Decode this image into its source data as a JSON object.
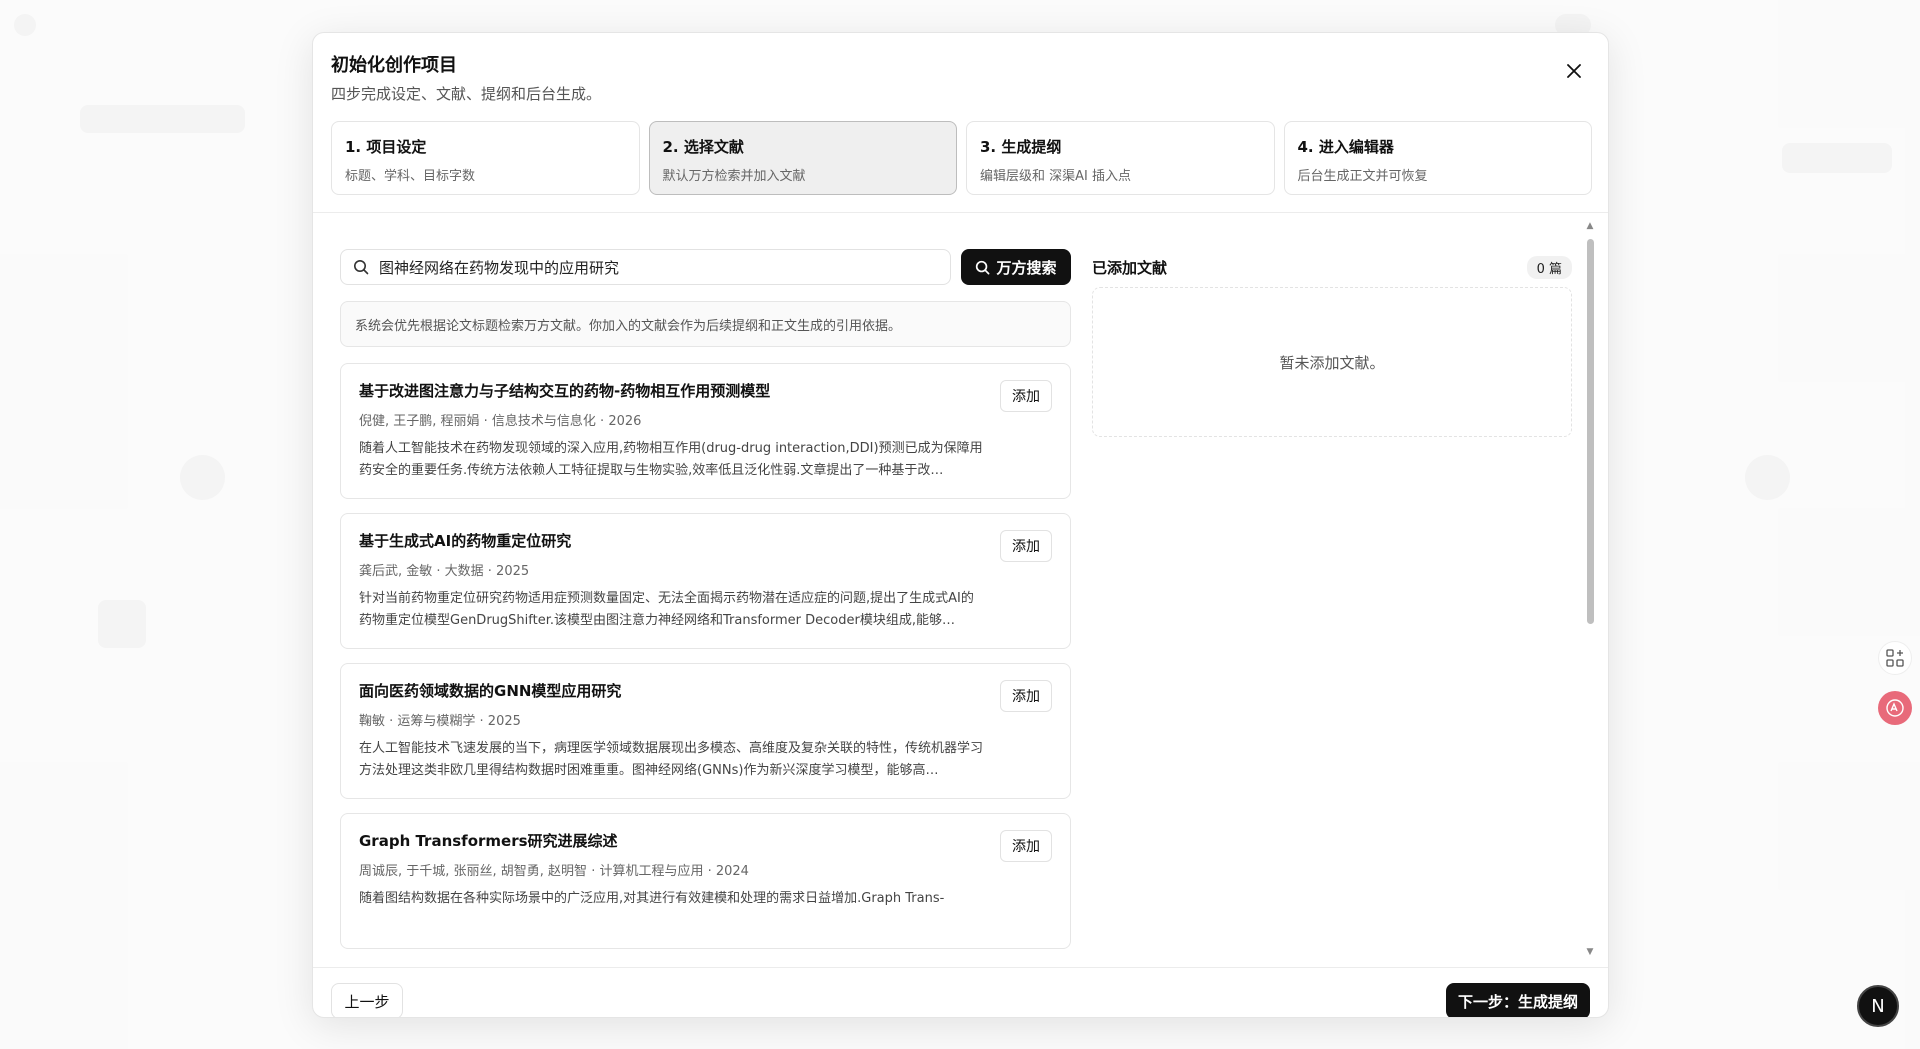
{
  "modal": {
    "title": "初始化创作项目",
    "subtitle": "四步完成设定、文献、提纲和后台生成。"
  },
  "steps": [
    {
      "title": "1. 项目设定",
      "desc": "标题、学科、目标字数",
      "active": false
    },
    {
      "title": "2. 选择文献",
      "desc": "默认万方检索并加入文献",
      "active": true
    },
    {
      "title": "3. 生成提纲",
      "desc": "编辑层级和 深渠AI 插入点",
      "active": false
    },
    {
      "title": "4. 进入编辑器",
      "desc": "后台生成正文并可恢复",
      "active": false
    }
  ],
  "search": {
    "value": "图神经网络在药物发现中的应用研究",
    "button_label": "万方搜索"
  },
  "hint": "系统会优先根据论文标题检索万方文献。你加入的文献会作为后续提纲和正文生成的引用依据。",
  "results": [
    {
      "title": "基于改进图注意力与子结构交互的药物-药物相互作用预测模型",
      "meta": "倪健, 王子鹏, 程丽娟 · 信息技术与信息化 · 2026",
      "abstract": "随着人工智能技术在药物发现领域的深入应用,药物相互作用(drug-drug interaction,DDI)预测已成为保障用药安全的重要任务.传统方法依赖人工特征提取与生物实验,效率低且泛化性弱.文章提出了一种基于改…",
      "add_label": "添加"
    },
    {
      "title": "基于生成式AI的药物重定位研究",
      "meta": "龚后武, 金敏 · 大数据 · 2025",
      "abstract": "针对当前药物重定位研究药物适用症预测数量固定、无法全面揭示药物潜在适应症的问题,提出了生成式AI的药物重定位模型GenDrugShifter.该模型由图注意力神经网络和Transformer Decoder模块组成,能够…",
      "add_label": "添加"
    },
    {
      "title": "面向医药领域数据的GNN模型应用研究",
      "meta": "鞠敏 · 运筹与模糊学 · 2025",
      "abstract": "在人工智能技术飞速发展的当下，病理医学领域数据展现出多模态、高维度及复杂关联的特性，传统机器学习方法处理这类非欧几里得结构数据时困难重重。图神经网络(GNNs)作为新兴深度学习模型，能够高…",
      "add_label": "添加"
    },
    {
      "title": "Graph Transformers研究进展综述",
      "meta": "周诚辰, 于千城, 张丽丝, 胡智勇, 赵明智 · 计算机工程与应用 · 2024",
      "abstract": "随着图结构数据在各种实际场景中的广泛应用,对其进行有效建模和处理的需求日益增加.Graph Trans-",
      "add_label": "添加"
    }
  ],
  "added": {
    "title": "已添加文献",
    "count": "0 篇",
    "empty_text": "暂未添加文献。"
  },
  "footer": {
    "prev_label": "上一步",
    "next_label": "下一步：生成提纲"
  },
  "fab": {
    "avatar_letter": "N"
  },
  "icons": {
    "close": "close-icon",
    "search": "search-icon",
    "apps": "apps-add-icon",
    "translate": "translate-icon"
  },
  "colors": {
    "primary": "#111111",
    "active_step_bg": "#efefef",
    "translate_fab": "#e86a7a"
  }
}
